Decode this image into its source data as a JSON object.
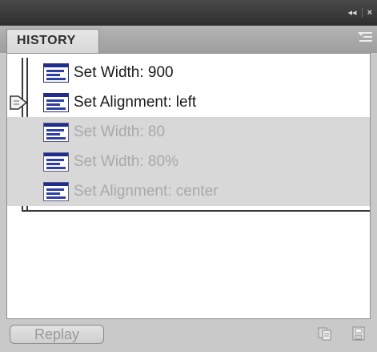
{
  "window": {
    "collapse_glyph": "◂◂",
    "close_glyph": "×"
  },
  "panel": {
    "tab_label": "HISTORY",
    "menu_icon": "panel-menu-icon"
  },
  "history": {
    "items": [
      {
        "label": "Set Width: 900",
        "state": "active"
      },
      {
        "label": "Set Alignment: left",
        "state": "current"
      },
      {
        "label": "Set Width: 80",
        "state": "undone"
      },
      {
        "label": "Set Width: 80%",
        "state": "undone"
      },
      {
        "label": "Set Alignment: center",
        "state": "undone"
      }
    ]
  },
  "footer": {
    "replay_label": "Replay",
    "copy_icon": "copy-steps-icon",
    "save_icon": "save-as-command-icon"
  },
  "colors": {
    "undone_bg": "#d8d8d8",
    "icon_blue": "#1f2d8f"
  }
}
